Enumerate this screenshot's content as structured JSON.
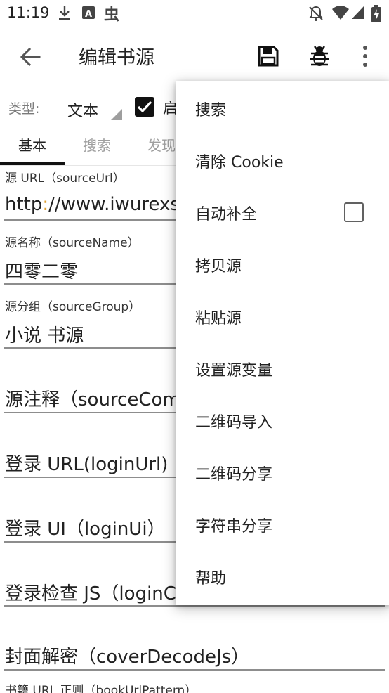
{
  "status_bar": {
    "time": "11:19",
    "icons_left": [
      "download-icon",
      "font-icon",
      "bug-notification-icon"
    ],
    "icons_right": [
      "notifications-off-icon",
      "wifi-icon",
      "signal-icon",
      "battery-charging-icon"
    ]
  },
  "app_bar": {
    "title": "编辑书源",
    "back_icon": "arrow-back-icon",
    "save_icon": "save-icon",
    "debug_icon": "bug-icon",
    "more_icon": "more-vert-icon"
  },
  "type_row": {
    "label": "类型:",
    "value": "文本",
    "enable_label": "启",
    "enabled": true
  },
  "tabs": [
    {
      "label": "基本",
      "active": true
    },
    {
      "label": "搜索",
      "active": false
    },
    {
      "label": "发现",
      "active": false
    }
  ],
  "fields": [
    {
      "label": "源 URL（sourceUrl）",
      "value": "http://www.iwurexs."
    },
    {
      "label": "源名称（sourceName）",
      "value": "四零二零"
    },
    {
      "label": "源分组（sourceGroup）",
      "value": "小说 书源"
    },
    {
      "label": "",
      "value": "源注释（sourceCom"
    },
    {
      "label": "",
      "value": "登录 URL(loginUrl)"
    },
    {
      "label": "",
      "value": "登录 UI（loginUi）"
    },
    {
      "label": "",
      "value": "登录检查 JS（loginC"
    },
    {
      "label": "",
      "value": "封面解密（coverDecodeJs）"
    },
    {
      "label": "书籍 URL 正则（bookUrlPattern）",
      "value": ""
    }
  ],
  "menu": {
    "items": [
      {
        "label": "搜索",
        "has_checkbox": false
      },
      {
        "label": "清除 Cookie",
        "has_checkbox": false
      },
      {
        "label": "自动补全",
        "has_checkbox": true,
        "checked": false
      },
      {
        "label": "拷贝源",
        "has_checkbox": false
      },
      {
        "label": "粘贴源",
        "has_checkbox": false
      },
      {
        "label": "设置源变量",
        "has_checkbox": false
      },
      {
        "label": "二维码导入",
        "has_checkbox": false
      },
      {
        "label": "二维码分享",
        "has_checkbox": false
      },
      {
        "label": "字符串分享",
        "has_checkbox": false
      },
      {
        "label": "帮助",
        "has_checkbox": false
      }
    ]
  },
  "colors": {
    "text": "#222222",
    "hint": "#9e9e9e",
    "accent_url_colon": "#e0a030",
    "underline": "#8d8d8d"
  }
}
